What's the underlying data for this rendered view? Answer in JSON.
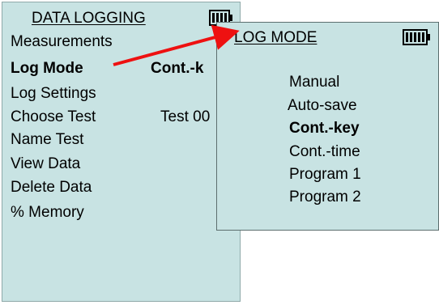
{
  "back_screen": {
    "title": "DATA LOGGING",
    "menu": [
      {
        "label": "Measurements"
      },
      {
        "label": "Log Mode",
        "value": "Cont.-k",
        "selected": true
      },
      {
        "label": "Log Settings"
      },
      {
        "label": "Choose Test",
        "value": "Test 00"
      },
      {
        "label": "Name Test"
      },
      {
        "label": "View Data"
      },
      {
        "label": "Delete Data"
      },
      {
        "label": "% Memory"
      }
    ],
    "battery_icon": "battery-icon"
  },
  "popup": {
    "title": "LOG MODE",
    "options": [
      {
        "label": "Manual"
      },
      {
        "label": "Auto-save"
      },
      {
        "label": "Cont.-key",
        "selected": true
      },
      {
        "label": "Cont.-time"
      },
      {
        "label": "Program 1"
      },
      {
        "label": "Program 2"
      }
    ],
    "battery_icon": "battery-icon"
  },
  "colors": {
    "screen_bg": "#c8e3e3",
    "arrow": "#ee1111"
  }
}
